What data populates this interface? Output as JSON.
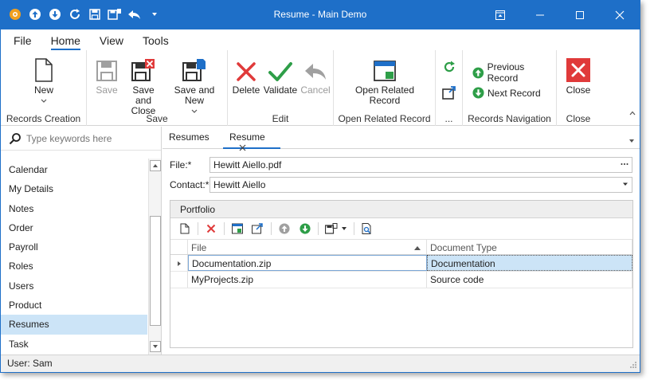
{
  "window": {
    "title": "Resume - Main Demo"
  },
  "ribbon_tabs": [
    "File",
    "Home",
    "View",
    "Tools"
  ],
  "ribbon": {
    "records_creation": {
      "label": "Records Creation",
      "new_label": "New"
    },
    "save": {
      "label": "Save",
      "save_label": "Save",
      "save_close_label": "Save and Close",
      "save_new_label": "Save and New"
    },
    "edit": {
      "label": "Edit",
      "delete_label": "Delete",
      "validate_label": "Validate",
      "cancel_label": "Cancel"
    },
    "open_related": {
      "label": "Open Related Record",
      "button_label": "Open Related Record"
    },
    "more": {
      "label": "..."
    },
    "navigation": {
      "label": "Records Navigation",
      "previous_label": "Previous Record",
      "next_label": "Next Record"
    },
    "close": {
      "label": "Close",
      "button_label": "Close"
    }
  },
  "nav": {
    "search_placeholder": "Type keywords here",
    "items": [
      "Calendar",
      "My Details",
      "Notes",
      "Order",
      "Payroll",
      "Roles",
      "Users",
      "Product",
      "Resumes",
      "Task"
    ],
    "selected": "Resumes"
  },
  "doc_tabs": {
    "first": "Resumes",
    "active": "Resume"
  },
  "form": {
    "file_label": "File:*",
    "file_value": "Hewitt Aiello.pdf",
    "contact_label": "Contact:*",
    "contact_value": "Hewitt Aiello"
  },
  "portfolio": {
    "title": "Portfolio",
    "columns": [
      "File",
      "Document Type"
    ],
    "rows": [
      [
        "Documentation.zip",
        "Documentation"
      ],
      [
        "MyProjects.zip",
        "Source code"
      ]
    ]
  },
  "status": {
    "user_text": "User: Sam"
  },
  "colors": {
    "accent": "#1e6fc8",
    "delete_red": "#e03a3a",
    "validate_green": "#2e9e48",
    "selection": "#cce4f7"
  }
}
